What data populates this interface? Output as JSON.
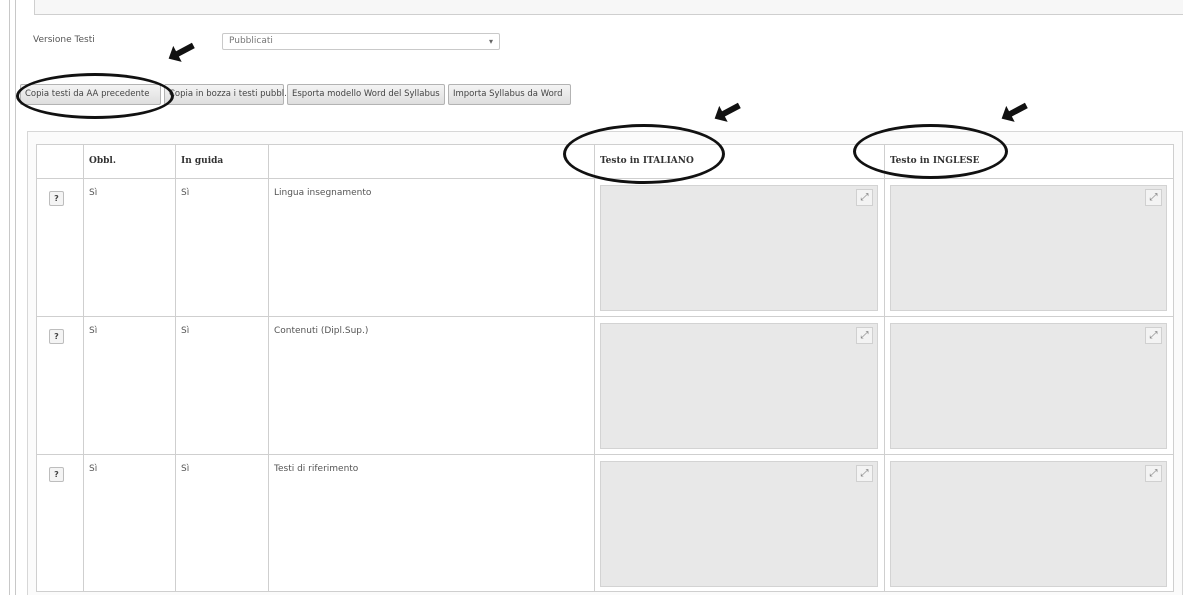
{
  "form": {
    "version_label": "Versione Testi",
    "version_select_value": "Pubblicati"
  },
  "toolbar": {
    "copy_prev_label": "Copia testi da AA precedente",
    "copy_draft_label": "Copia in bozza i testi pubbl.",
    "export_word_label": "Esporta modello Word del Syllabus",
    "import_word_label": "Importa Syllabus da Word"
  },
  "table": {
    "headers": {
      "help": "",
      "obbl": "Obbl.",
      "in_guida": "In guida",
      "field": "",
      "italian": "Testo in ITALIANO",
      "english": "Testo in INGLESE"
    },
    "rows": [
      {
        "help_icon": "?",
        "obbl": "Sì",
        "in_guida": "Sì",
        "field": "Lingua insegnamento"
      },
      {
        "help_icon": "?",
        "obbl": "Sì",
        "in_guida": "Sì",
        "field": "Contenuti (Dipl.Sup.)"
      },
      {
        "help_icon": "?",
        "obbl": "Sì",
        "in_guida": "Sì",
        "field": "Testi di riferimento"
      }
    ]
  },
  "icons": {
    "select_caret": "chevron-down-icon",
    "help": "help-icon",
    "resize": "expand-icon",
    "annotation_arrow": "arrow-icon"
  }
}
